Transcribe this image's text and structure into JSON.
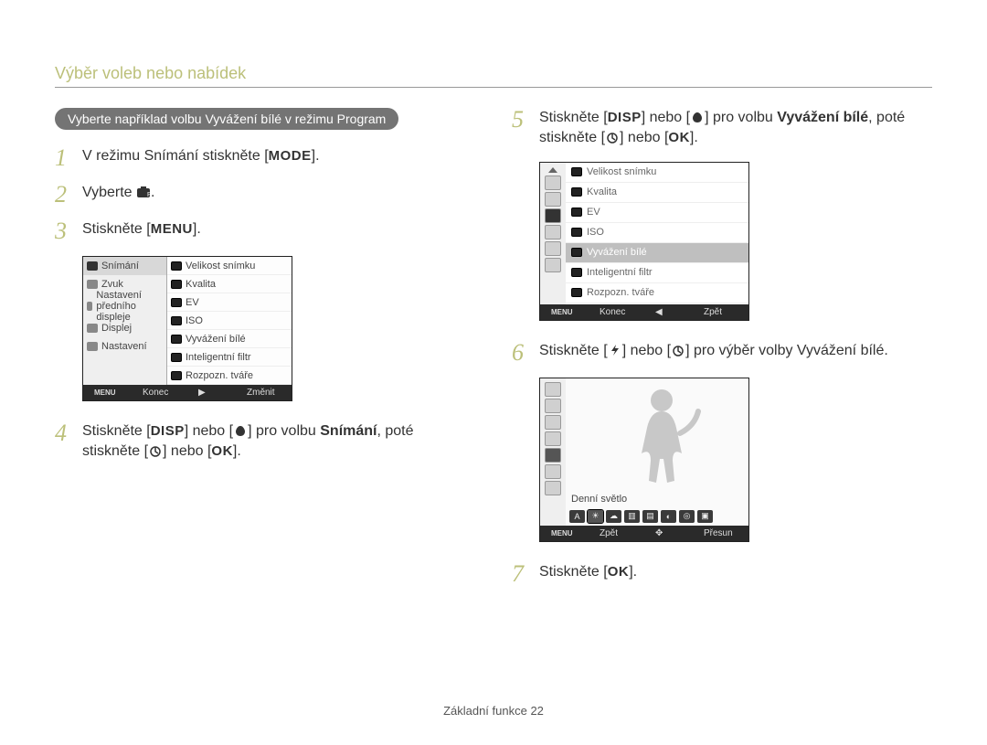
{
  "page": {
    "title": "Výběr voleb nebo nabídek",
    "footer": "Základní funkce  22"
  },
  "pill": "Vyberte například volbu Vyvážení bílé v režimu Program",
  "labels": {
    "mode": "MODE",
    "menu": "MENU",
    "disp": "DISP",
    "ok": "OK"
  },
  "steps": {
    "s1_a": "V režimu Snímání stiskněte [",
    "s1_b": "].",
    "s2_a": "Vyberte ",
    "s2_b": ".",
    "s3_a": "Stiskněte [",
    "s3_b": "].",
    "s4_a": "Stiskněte [",
    "s4_b": "] nebo [",
    "s4_c": "] pro volbu ",
    "s4_bold": "Snímání",
    "s4_d": ", poté stiskněte [",
    "s4_e": "] nebo [",
    "s4_f": "].",
    "s5_a": "Stiskněte [",
    "s5_b": "] nebo [",
    "s5_c": "] pro volbu ",
    "s5_bold": "Vyvážení bílé",
    "s5_d": ", poté stiskněte [",
    "s5_e": "] nebo [",
    "s5_f": "].",
    "s6": "Stiskněte [",
    "s6_b": "] nebo [",
    "s6_c": "] pro výběr volby Vyvážení bílé.",
    "s7_a": "Stiskněte [",
    "s7_b": "]."
  },
  "screen1": {
    "left": [
      "Snímání",
      "Zvuk",
      "Nastavení předního displeje",
      "Displej",
      "Nastavení"
    ],
    "right": [
      "Velikost snímku",
      "Kvalita",
      "EV",
      "ISO",
      "Vyvážení bílé",
      "Inteligentní filtr",
      "Rozpozn. tváře"
    ],
    "footer_left": "Konec",
    "footer_right": "Změnit"
  },
  "screen2": {
    "rows": [
      "Velikost snímku",
      "Kvalita",
      "EV",
      "ISO",
      "Vyvážení bílé",
      "Inteligentní filtr",
      "Rozpozn. tváře"
    ],
    "selected": "Vyvážení bílé",
    "footer_left": "Konec",
    "footer_right": "Zpět"
  },
  "screen3": {
    "label": "Denní světlo",
    "footer_left": "Zpět",
    "footer_right": "Přesun"
  }
}
